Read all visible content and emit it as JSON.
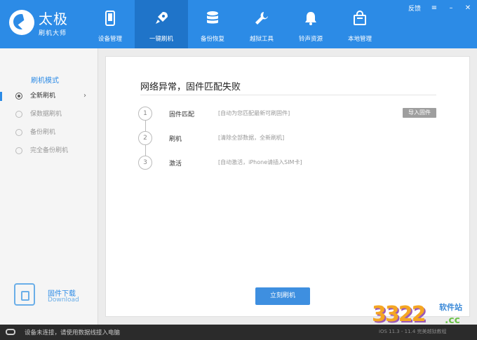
{
  "app": {
    "title_main": "太极",
    "title_sub": "刷机大师"
  },
  "nav": {
    "items": [
      {
        "label": "设备管理",
        "icon": "phone-icon"
      },
      {
        "label": "一键刷机",
        "icon": "rocket-icon"
      },
      {
        "label": "备份恢复",
        "icon": "database-icon"
      },
      {
        "label": "越狱工具",
        "icon": "wrench-icon"
      },
      {
        "label": "铃声资源",
        "icon": "bell-icon"
      },
      {
        "label": "本地管理",
        "icon": "bag-icon"
      }
    ],
    "active_index": 1
  },
  "window": {
    "feedback": "反馈",
    "menu_icon": "menu-icon",
    "minimize_icon": "minimize-icon",
    "close_icon": "close-icon"
  },
  "sidebar": {
    "title": "刷机模式",
    "items": [
      {
        "label": "全新刷机",
        "icon": "radio-icon",
        "active": true
      },
      {
        "label": "保数据刷机",
        "icon": "clock-icon",
        "active": false
      },
      {
        "label": "备份刷机",
        "icon": "ban-icon",
        "active": false
      },
      {
        "label": "完全备份刷机",
        "icon": "refresh-icon",
        "active": false
      }
    ],
    "download": {
      "title": "固件下载",
      "subtitle": "Download"
    }
  },
  "main": {
    "title": "网络异常，固件匹配失败",
    "steps": [
      {
        "num": "1",
        "name": "固件匹配",
        "desc": "[自动为您匹配最新可刷固件]"
      },
      {
        "num": "2",
        "name": "刷机",
        "desc": "[清除全部数据，全新刷机]"
      },
      {
        "num": "3",
        "name": "激活",
        "desc": "[自动激活，iPhone请插入SIM卡]"
      }
    ],
    "import_button": "导入固件",
    "flash_button": "立刻刷机"
  },
  "statusbar": {
    "message": "设备未连接，请使用数据线接入电脑",
    "version": "iOS 11.3 - 11.4 完美越狱教程"
  },
  "watermark": {
    "number": "3322",
    "site": "软件站",
    "domain": ".cc"
  },
  "colors": {
    "header": "#2c8be6",
    "nav_active": "#1f74c9",
    "button": "#3e8fe0",
    "statusbar": "#2b2b2b"
  }
}
